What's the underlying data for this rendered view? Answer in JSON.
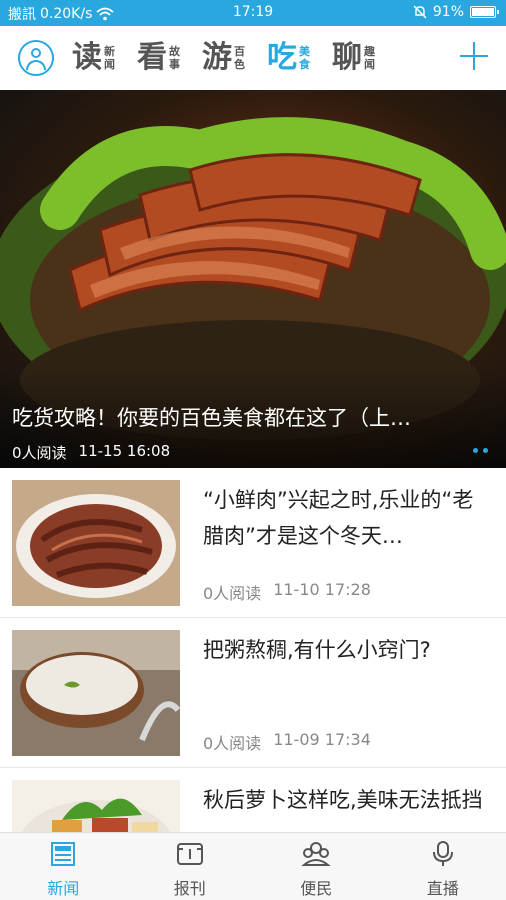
{
  "status_bar": {
    "carrier": "搬訊",
    "speed": "0.20K/s",
    "time": "17:19",
    "battery": "91%",
    "battery_level": 0.91
  },
  "header": {
    "tabs": [
      {
        "big": "读",
        "small": [
          "新",
          "闻"
        ]
      },
      {
        "big": "看",
        "small": [
          "故",
          "事"
        ]
      },
      {
        "big": "游",
        "small": [
          "百",
          "色"
        ]
      },
      {
        "big": "吃",
        "small": [
          "美",
          "食"
        ]
      },
      {
        "big": "聊",
        "small": [
          "趣",
          "闻"
        ]
      }
    ],
    "active_tab_index": 3
  },
  "hero": {
    "title": "吃货攻略！你要的百色美食都在这了（上…",
    "reads": "0人阅读",
    "datetime": "11-15 16:08",
    "slide_count": 2
  },
  "articles": [
    {
      "title": "“小鲜肉”兴起之时,乐业的“老腊肉”才是这个冬天…",
      "reads": "0人阅读",
      "datetime": "11-10 17:28"
    },
    {
      "title": "把粥熬稠,有什么小窍门?",
      "reads": "0人阅读",
      "datetime": "11-09 17:34"
    },
    {
      "title": "秋后萝卜这样吃,美味无法抵挡",
      "reads": "",
      "datetime": ""
    }
  ],
  "bottom_nav": [
    {
      "label": "新闻",
      "icon": "news-icon"
    },
    {
      "label": "报刊",
      "icon": "newspaper-icon"
    },
    {
      "label": "便民",
      "icon": "people-icon"
    },
    {
      "label": "直播",
      "icon": "microphone-icon"
    }
  ],
  "colors": {
    "accent": "#29a8e0",
    "status_bar": "#29a8e0"
  }
}
